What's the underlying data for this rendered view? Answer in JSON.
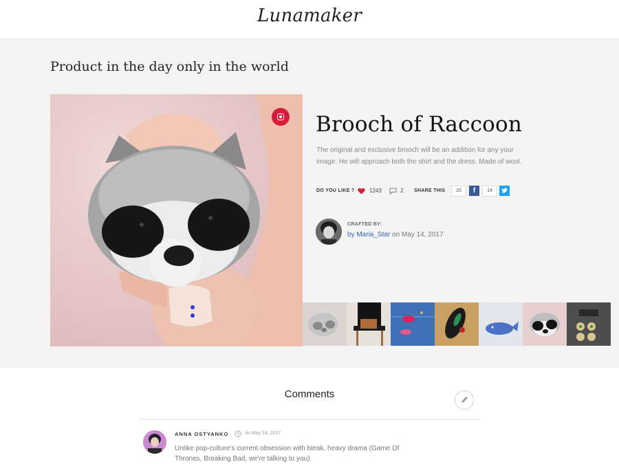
{
  "header": {
    "logo_text": "Lunamaker"
  },
  "section": {
    "title": "Product in the day only in the world"
  },
  "product": {
    "title": "Brooch of Raccoon",
    "description": "The original and exclusive brooch will be an addition for any your image. He will approach both the shirt and the dress. Made of wool.",
    "main_image_icon": "instagram-icon"
  },
  "engagement": {
    "like_label": "DO YOU LIKE ?",
    "likes": "1243",
    "comments": "2",
    "share_label": "SHARE THIS",
    "facebook_count": "20",
    "twitter_count": "14"
  },
  "author": {
    "crafted_label": "CRAFTED BY:",
    "by_prefix": "by",
    "name": "Maria_Star",
    "date": "on May 14, 2017"
  },
  "thumbnails": [
    {
      "name": "raccoon-brooch-faded"
    },
    {
      "name": "leather-bag-on-chair"
    },
    {
      "name": "lip-patches-on-denim"
    },
    {
      "name": "feather-brooch"
    },
    {
      "name": "whale-brooch"
    },
    {
      "name": "raccoon-brooch"
    },
    {
      "name": "owl-cufflinks"
    }
  ],
  "comments_section": {
    "title": "Comments",
    "items": [
      {
        "author": "ANNA OSTYANKO",
        "date": "on May 14, 2017",
        "text": "Unlike pop-culture's current obsession with bleak, heavy drama (Game Of Thrones, Breaking Bad, we're talking to you)"
      }
    ]
  },
  "colors": {
    "band_bg": "#f4f4f4",
    "accent_link": "#2e66b8",
    "like_heart": "#d0213a",
    "facebook": "#3b5998",
    "twitter": "#1da1f2",
    "instagram": "#d81b3a"
  }
}
